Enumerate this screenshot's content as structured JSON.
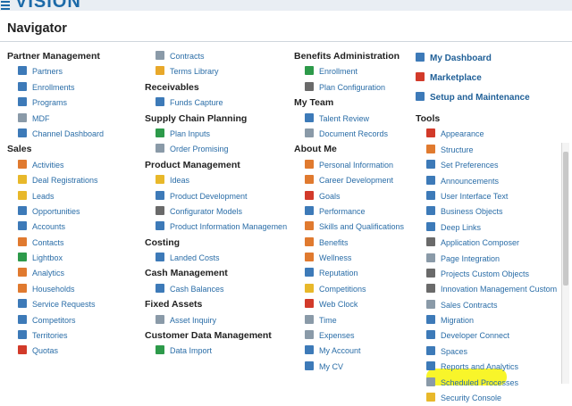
{
  "app": {
    "brand": "VISION",
    "menu_icon": "hamburger-icon"
  },
  "page": {
    "title": "Navigator"
  },
  "columns": [
    {
      "sections": [
        {
          "heading": "Partner Management",
          "items": [
            {
              "label": "Partners",
              "icon": "partners-icon",
              "color": "#3d7ab8"
            },
            {
              "label": "Enrollments",
              "icon": "enrollments-icon",
              "color": "#3d7ab8"
            },
            {
              "label": "Programs",
              "icon": "programs-icon",
              "color": "#3d7ab8"
            },
            {
              "label": "MDF",
              "icon": "mdf-icon",
              "color": "#8a9aa8"
            },
            {
              "label": "Channel Dashboard",
              "icon": "channel-dashboard-icon",
              "color": "#3d7ab8"
            }
          ]
        },
        {
          "heading": "Sales",
          "items": [
            {
              "label": "Activities",
              "icon": "activities-icon",
              "color": "#e07a2f"
            },
            {
              "label": "Deal Registrations",
              "icon": "deal-registrations-icon",
              "color": "#e8b82a"
            },
            {
              "label": "Leads",
              "icon": "leads-icon",
              "color": "#e8b82a"
            },
            {
              "label": "Opportunities",
              "icon": "opportunities-icon",
              "color": "#3d7ab8"
            },
            {
              "label": "Accounts",
              "icon": "accounts-icon",
              "color": "#3d7ab8"
            },
            {
              "label": "Contacts",
              "icon": "contacts-icon",
              "color": "#e07a2f"
            },
            {
              "label": "Lightbox",
              "icon": "lightbox-icon",
              "color": "#2d9a4a"
            },
            {
              "label": "Analytics",
              "icon": "analytics-icon",
              "color": "#e07a2f"
            },
            {
              "label": "Households",
              "icon": "households-icon",
              "color": "#e07a2f"
            },
            {
              "label": "Service Requests",
              "icon": "service-requests-icon",
              "color": "#3d7ab8"
            },
            {
              "label": "Competitors",
              "icon": "competitors-icon",
              "color": "#3d7ab8"
            },
            {
              "label": "Territories",
              "icon": "territories-icon",
              "color": "#3d7ab8"
            },
            {
              "label": "Quotas",
              "icon": "quotas-icon",
              "color": "#d23a2a"
            }
          ]
        }
      ]
    },
    {
      "sections": [
        {
          "heading": "",
          "items": [
            {
              "label": "Contracts",
              "icon": "contracts-icon",
              "color": "#8a9aa8"
            },
            {
              "label": "Terms Library",
              "icon": "terms-library-icon",
              "color": "#e8a82a"
            }
          ]
        },
        {
          "heading": "Receivables",
          "items": [
            {
              "label": "Funds Capture",
              "icon": "funds-capture-icon",
              "color": "#3d7ab8"
            }
          ]
        },
        {
          "heading": "Supply Chain Planning",
          "items": [
            {
              "label": "Plan Inputs",
              "icon": "plan-inputs-icon",
              "color": "#2d9a4a"
            },
            {
              "label": "Order Promising",
              "icon": "order-promising-icon",
              "color": "#8a9aa8"
            }
          ]
        },
        {
          "heading": "Product Management",
          "items": [
            {
              "label": "Ideas",
              "icon": "ideas-icon",
              "color": "#e8b82a"
            },
            {
              "label": "Product Development",
              "icon": "product-development-icon",
              "color": "#3d7ab8"
            },
            {
              "label": "Configurator Models",
              "icon": "configurator-models-icon",
              "color": "#6a6a6a"
            },
            {
              "label": "Product Information Managemen...",
              "icon": "product-information-icon",
              "color": "#3d7ab8"
            }
          ]
        },
        {
          "heading": "Costing",
          "items": [
            {
              "label": "Landed Costs",
              "icon": "landed-costs-icon",
              "color": "#3d7ab8"
            }
          ]
        },
        {
          "heading": "Cash Management",
          "items": [
            {
              "label": "Cash Balances",
              "icon": "cash-balances-icon",
              "color": "#3d7ab8"
            }
          ]
        },
        {
          "heading": "Fixed Assets",
          "items": [
            {
              "label": "Asset Inquiry",
              "icon": "asset-inquiry-icon",
              "color": "#8a9aa8"
            }
          ]
        },
        {
          "heading": "Customer Data Management",
          "items": [
            {
              "label": "Data Import",
              "icon": "data-import-icon",
              "color": "#2d9a4a"
            }
          ]
        }
      ]
    },
    {
      "sections": [
        {
          "heading": "Benefits Administration",
          "items": [
            {
              "label": "Enrollment",
              "icon": "enrollment-icon",
              "color": "#2d9a4a"
            },
            {
              "label": "Plan Configuration",
              "icon": "plan-configuration-icon",
              "color": "#6a6a6a"
            }
          ]
        },
        {
          "heading": "My Team",
          "items": [
            {
              "label": "Talent Review",
              "icon": "talent-review-icon",
              "color": "#3d7ab8"
            },
            {
              "label": "Document Records",
              "icon": "document-records-icon",
              "color": "#8a9aa8"
            }
          ]
        },
        {
          "heading": "About Me",
          "items": [
            {
              "label": "Personal Information",
              "icon": "personal-information-icon",
              "color": "#e07a2f"
            },
            {
              "label": "Career Development",
              "icon": "career-development-icon",
              "color": "#e07a2f"
            },
            {
              "label": "Goals",
              "icon": "goals-icon",
              "color": "#d23a2a"
            },
            {
              "label": "Performance",
              "icon": "performance-icon",
              "color": "#3d7ab8"
            },
            {
              "label": "Skills and Qualifications",
              "icon": "skills-icon",
              "color": "#e07a2f"
            },
            {
              "label": "Benefits",
              "icon": "benefits-icon",
              "color": "#e07a2f"
            },
            {
              "label": "Wellness",
              "icon": "wellness-icon",
              "color": "#e07a2f"
            },
            {
              "label": "Reputation",
              "icon": "reputation-icon",
              "color": "#3d7ab8"
            },
            {
              "label": "Competitions",
              "icon": "competitions-icon",
              "color": "#e8b82a"
            },
            {
              "label": "Web Clock",
              "icon": "web-clock-icon",
              "color": "#d23a2a"
            },
            {
              "label": "Time",
              "icon": "time-icon",
              "color": "#8a9aa8"
            },
            {
              "label": "Expenses",
              "icon": "expenses-icon",
              "color": "#8a9aa8"
            },
            {
              "label": "My Account",
              "icon": "my-account-icon",
              "color": "#3d7ab8"
            },
            {
              "label": "My CV",
              "icon": "my-cv-icon",
              "color": "#3d7ab8"
            }
          ]
        }
      ]
    },
    {
      "top_links": [
        {
          "label": "My Dashboard",
          "icon": "dashboard-icon",
          "color": "#3d7ab8"
        },
        {
          "label": "Marketplace",
          "icon": "marketplace-icon",
          "color": "#d23a2a"
        },
        {
          "label": "Setup and Maintenance",
          "icon": "setup-icon",
          "color": "#3d7ab8"
        }
      ],
      "sections": [
        {
          "heading": "Tools",
          "items": [
            {
              "label": "Appearance",
              "icon": "appearance-icon",
              "color": "#d23a2a"
            },
            {
              "label": "Structure",
              "icon": "structure-icon",
              "color": "#e07a2f"
            },
            {
              "label": "Set Preferences",
              "icon": "preferences-icon",
              "color": "#3d7ab8"
            },
            {
              "label": "Announcements",
              "icon": "announcements-icon",
              "color": "#3d7ab8"
            },
            {
              "label": "User Interface Text",
              "icon": "ui-text-icon",
              "color": "#3d7ab8"
            },
            {
              "label": "Business Objects",
              "icon": "business-objects-icon",
              "color": "#3d7ab8"
            },
            {
              "label": "Deep Links",
              "icon": "deep-links-icon",
              "color": "#3d7ab8"
            },
            {
              "label": "Application Composer",
              "icon": "application-composer-icon",
              "color": "#6a6a6a"
            },
            {
              "label": "Page Integration",
              "icon": "page-integration-icon",
              "color": "#8a9aa8"
            },
            {
              "label": "Projects Custom Objects",
              "icon": "projects-custom-objects-icon",
              "color": "#6a6a6a"
            },
            {
              "label": "Innovation Management Custom ...",
              "icon": "innovation-icon",
              "color": "#6a6a6a"
            },
            {
              "label": "Sales Contracts",
              "icon": "sales-contracts-icon",
              "color": "#8a9aa8"
            },
            {
              "label": "Migration",
              "icon": "migration-icon",
              "color": "#3d7ab8"
            },
            {
              "label": "Developer Connect",
              "icon": "developer-connect-icon",
              "color": "#3d7ab8"
            },
            {
              "label": "Spaces",
              "icon": "spaces-icon",
              "color": "#3d7ab8"
            },
            {
              "label": "Reports and Analytics",
              "icon": "reports-analytics-icon",
              "color": "#3d7ab8"
            },
            {
              "label": "Scheduled Processes",
              "icon": "scheduled-processes-icon",
              "color": "#8a9aa8"
            },
            {
              "label": "Security Console",
              "icon": "security-console-icon",
              "color": "#e8b82a"
            }
          ]
        }
      ]
    }
  ],
  "highlight_color": "#f8f52a"
}
